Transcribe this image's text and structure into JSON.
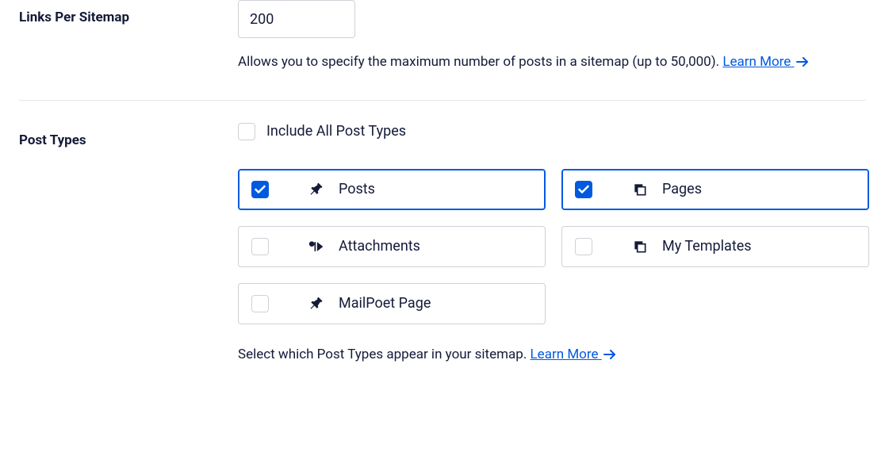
{
  "links_per_sitemap": {
    "label": "Links Per Sitemap",
    "value": "200",
    "description": "Allows you to specify the maximum number of posts in a sitemap (up to 50,000).",
    "learn_more": "Learn More"
  },
  "post_types": {
    "label": "Post Types",
    "include_all_label": "Include All Post Types",
    "include_all_checked": false,
    "items": [
      {
        "label": "Posts",
        "checked": true,
        "icon": "pin"
      },
      {
        "label": "Pages",
        "checked": true,
        "icon": "stack"
      },
      {
        "label": "Attachments",
        "checked": false,
        "icon": "media"
      },
      {
        "label": "My Templates",
        "checked": false,
        "icon": "stack"
      },
      {
        "label": "MailPoet Page",
        "checked": false,
        "icon": "pin"
      }
    ],
    "description": "Select which Post Types appear in your sitemap.",
    "learn_more": "Learn More"
  },
  "colors": {
    "accent": "#005AE0",
    "text": "#141B38",
    "border": "#D0D1D7"
  }
}
